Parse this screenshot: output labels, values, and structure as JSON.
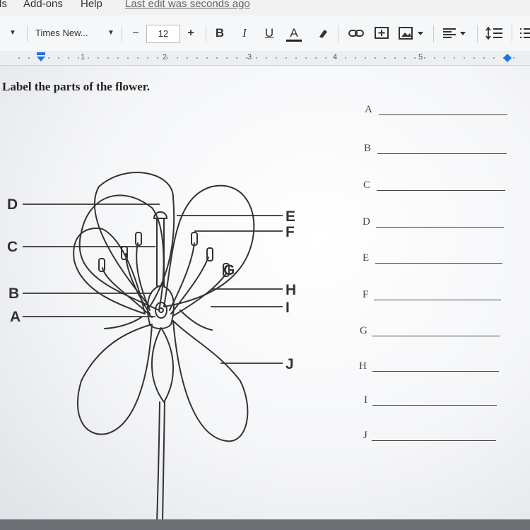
{
  "menubar": {
    "tools": "ls",
    "addons": "Add-ons",
    "help": "Help",
    "last_edit": "Last edit was seconds ago"
  },
  "toolbar": {
    "font": "Times New...",
    "font_size": "12",
    "minus": "−",
    "plus": "+",
    "bold": "B",
    "italic": "I",
    "underline": "U",
    "text_color": "A"
  },
  "ruler": {
    "marks": [
      "1",
      "2",
      "3",
      "4",
      "5"
    ]
  },
  "document": {
    "heading": "Label the parts of the flower.",
    "answers": [
      "A",
      "B",
      "C",
      "D",
      "E",
      "F",
      "G",
      "H",
      "I",
      "J"
    ]
  },
  "diagram": {
    "labels": {
      "D": "D",
      "C": "C",
      "B": "B",
      "A": "A",
      "E": "E",
      "F": "F",
      "G": "G",
      "H": "H",
      "I": "I",
      "J": "J"
    }
  }
}
